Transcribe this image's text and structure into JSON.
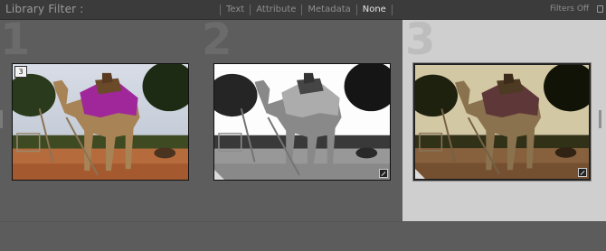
{
  "filter_bar": {
    "title": "Library Filter :",
    "tabs": [
      {
        "label": "Text",
        "active": false
      },
      {
        "label": "Attribute",
        "active": false
      },
      {
        "label": "Metadata",
        "active": false
      },
      {
        "label": "None",
        "active": true
      }
    ],
    "preset": "Filters Off",
    "lock_icon": "lock-icon"
  },
  "grid": {
    "cells": [
      {
        "index_label": "1",
        "badge": "3",
        "selected": false,
        "style": "color"
      },
      {
        "index_label": "2",
        "badge": "",
        "selected": false,
        "style": "black-and-white"
      },
      {
        "index_label": "3",
        "badge": "",
        "selected": true,
        "style": "sepia"
      }
    ]
  },
  "colors": {
    "panel_bg": "#5e5e5e",
    "selected_cell_bg": "#cfcfcf",
    "filter_bar_bg": "#3b3b3b"
  }
}
